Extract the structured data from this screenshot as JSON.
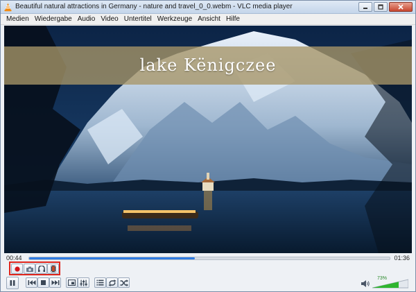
{
  "window": {
    "title": "Beautiful natural attractions in Germany - nature and travel_0_0.webm - VLC media player",
    "controls": [
      "minimize-icon",
      "maximize-icon",
      "close-icon"
    ]
  },
  "menu": {
    "items": [
      "Medien",
      "Wiedergabe",
      "Audio",
      "Video",
      "Untertitel",
      "Werkzeuge",
      "Ansicht",
      "Hilfe"
    ]
  },
  "video": {
    "subtitle": "lake Kënigczee"
  },
  "playback": {
    "current_time": "00:44",
    "total_time": "01:36",
    "progress": 0.46
  },
  "advanced_controls": {
    "highlight_color": "#e0251b",
    "buttons": [
      "record-icon",
      "snapshot-icon",
      "loop-ab-icon",
      "frame-step-icon"
    ]
  },
  "controls": {
    "buttons": [
      "pause-icon",
      "previous-icon",
      "stop-icon",
      "next-icon",
      "fullscreen-icon",
      "extended-settings-icon",
      "playlist-icon",
      "loop-icon",
      "shuffle-icon"
    ]
  },
  "volume": {
    "label": "73%",
    "level": 0.73,
    "accent": "#2fb52f"
  }
}
